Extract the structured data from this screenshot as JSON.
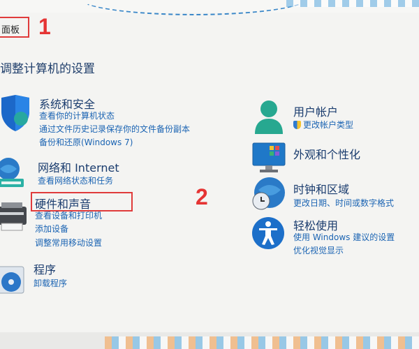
{
  "breadcrumb": "面板",
  "markers": {
    "one": "1",
    "two": "2"
  },
  "page_title": "调整计算机的设置",
  "left": {
    "system": {
      "title": "系统和安全",
      "links": [
        "查看你的计算机状态",
        "通过文件历史记录保存你的文件备份副本",
        "备份和还原(Windows 7)"
      ]
    },
    "network": {
      "title": "网络和 Internet",
      "links": [
        "查看网络状态和任务"
      ]
    },
    "hardware": {
      "title": "硬件和声音",
      "links": [
        "查看设备和打印机",
        "添加设备",
        "调整常用移动设置"
      ]
    },
    "programs": {
      "title": "程序",
      "links": [
        "卸载程序"
      ]
    }
  },
  "right": {
    "user": {
      "title": "用户帐户",
      "links": [
        "更改帐户类型"
      ]
    },
    "appearance": {
      "title": "外观和个性化"
    },
    "clock": {
      "title": "时钟和区域",
      "links": [
        "更改日期、时间或数字格式"
      ]
    },
    "access": {
      "title": "轻松使用",
      "links": [
        "使用 Windows 建议的设置",
        "优化视觉显示"
      ]
    }
  },
  "colors": {
    "accent": "#1b64b3",
    "title": "#1a3c6e",
    "highlight": "#e03b3b"
  }
}
